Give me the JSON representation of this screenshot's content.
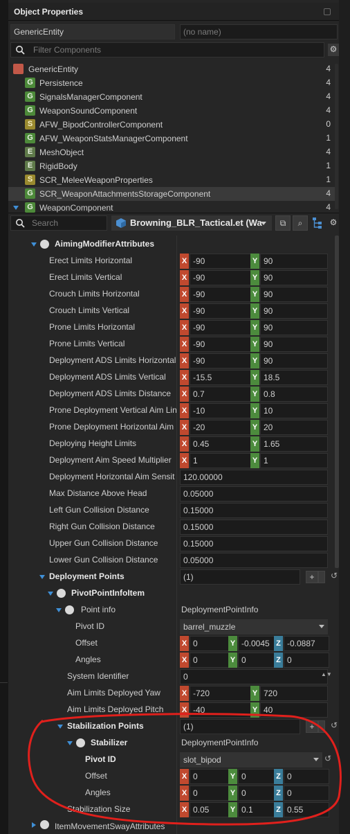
{
  "panel": {
    "title": "Object Properties"
  },
  "entity": {
    "type": "GenericEntity",
    "name_placeholder": "(no name)"
  },
  "filter": {
    "placeholder": "Filter Components"
  },
  "components": [
    {
      "icon": "entity",
      "label": "GenericEntity",
      "count": "4"
    },
    {
      "icon": "G",
      "label": "Persistence",
      "count": "4"
    },
    {
      "icon": "G",
      "label": "SignalsManagerComponent",
      "count": "4"
    },
    {
      "icon": "G",
      "label": "WeaponSoundComponent",
      "count": "4"
    },
    {
      "icon": "S",
      "label": "AFW_BipodControllerComponent",
      "count": "0"
    },
    {
      "icon": "G",
      "label": "AFW_WeaponStatsManagerComponent",
      "count": "1"
    },
    {
      "icon": "E",
      "label": "MeshObject",
      "count": "4"
    },
    {
      "icon": "E",
      "label": "RigidBody",
      "count": "1"
    },
    {
      "icon": "S",
      "label": "SCR_MeleeWeaponProperties",
      "count": "1"
    },
    {
      "icon": "G",
      "label": "SCR_WeaponAttachmentsStorageComponent",
      "count": "4"
    },
    {
      "icon": "G",
      "label": "WeaponComponent",
      "count": "4"
    }
  ],
  "toolbar": {
    "search_placeholder": "Search",
    "prefab": "Browning_BLR_Tactical.et (Wa"
  },
  "sections": {
    "aiming": "AimingModifierAttributes",
    "deployment_points": "Deployment Points",
    "pivot_item": "PivotPointInfoItem",
    "point_info": "Point info",
    "point_info_value": "DeploymentPointInfo",
    "stab_points": "Stabilization Points",
    "stabilizer": "Stabilizer",
    "stabilizer_value": "DeploymentPointInfo",
    "item_sway": "ItemMovementSwayAttributes"
  },
  "limits": [
    {
      "label": "Erect Limits Horizontal",
      "x": "-90",
      "y": "90"
    },
    {
      "label": "Erect Limits Vertical",
      "x": "-90",
      "y": "90"
    },
    {
      "label": "Crouch Limits Horizontal",
      "x": "-90",
      "y": "90"
    },
    {
      "label": "Crouch Limits Vertical",
      "x": "-90",
      "y": "90"
    },
    {
      "label": "Prone Limits Horizontal",
      "x": "-90",
      "y": "90"
    },
    {
      "label": "Prone Limits Vertical",
      "x": "-90",
      "y": "90"
    },
    {
      "label": "Deployment ADS Limits Horizontal",
      "x": "-90",
      "y": "90"
    },
    {
      "label": "Deployment ADS Limits Vertical",
      "x": "-15.5",
      "y": "18.5"
    },
    {
      "label": "Deployment ADS Limits Distance",
      "x": "0.7",
      "y": "0.8"
    },
    {
      "label": "Prone Deployment Vertical Aim Lin",
      "x": "-10",
      "y": "10"
    },
    {
      "label": "Prone Deployment Horizontal Aim",
      "x": "-20",
      "y": "20"
    },
    {
      "label": "Deploying Height Limits",
      "x": "0.45",
      "y": "1.65"
    },
    {
      "label": "Deployment Aim Speed Multiplier",
      "x": "1",
      "y": "1"
    }
  ],
  "scalars": [
    {
      "label": "Deployment Horizontal Aim Sensit",
      "value": "120.00000"
    },
    {
      "label": "Max Distance Above Head",
      "value": "0.05000"
    },
    {
      "label": "Left Gun Collision Distance",
      "value": "0.15000"
    },
    {
      "label": "Right Gun Collision Distance",
      "value": "0.15000"
    },
    {
      "label": "Upper Gun Collision Distance",
      "value": "0.15000"
    },
    {
      "label": "Lower Gun Collision Distance",
      "value": "0.05000"
    }
  ],
  "deployment": {
    "count": "(1)",
    "pivot_id_label": "Pivot ID",
    "pivot_id": "barrel_muzzle",
    "offset_label": "Offset",
    "offset": {
      "x": "0",
      "y": "-0.0045",
      "z": "-0.0887"
    },
    "angles_label": "Angles",
    "angles": {
      "x": "0",
      "y": "0",
      "z": "0"
    },
    "system_id_label": "System Identifier",
    "system_id": "0",
    "yaw_label": "Aim Limits Deployed Yaw",
    "yaw": {
      "x": "-720",
      "y": "720"
    },
    "pitch_label": "Aim Limits Deployed Pitch",
    "pitch": {
      "x": "-40",
      "y": "40"
    }
  },
  "stabilization": {
    "count": "(1)",
    "pivot_id_label": "Pivot ID",
    "pivot_id": "slot_bipod",
    "offset_label": "Offset",
    "offset": {
      "x": "0",
      "y": "0",
      "z": "0"
    },
    "angles_label": "Angles",
    "angles": {
      "x": "0",
      "y": "0",
      "z": "0"
    },
    "size_label": "Stabilization Size",
    "size": {
      "x": "0.05",
      "y": "0.1",
      "z": "0.55"
    }
  },
  "axes": {
    "x": "X",
    "y": "Y",
    "z": "Z"
  },
  "icons": [
    "gear-icon",
    "search-icon",
    "cube-icon",
    "open-external-icon",
    "hierarchy-icon",
    "reset-icon",
    "dropdown-arrow-icon"
  ],
  "colors": {
    "x_axis": "#c0492f",
    "y_axis": "#4c8b3d",
    "z_axis": "#3a7d9a",
    "annotation": "#e0201c",
    "tree_arrow": "#3f8fd6"
  }
}
